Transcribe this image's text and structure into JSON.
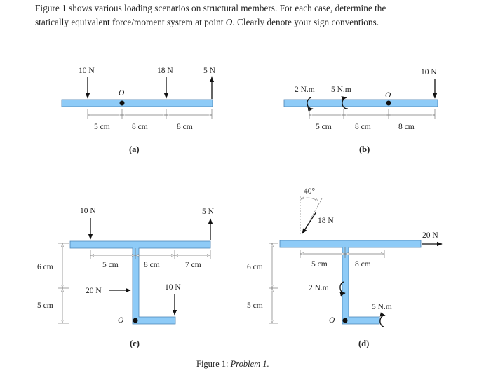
{
  "intro": {
    "line1": "Figure 1 shows various loading scenarios on structural members.  For each case, determine the",
    "line2_a": "statically equivalent force/moment system at point ",
    "line2_point": "O",
    "line2_b": ". Clearly denote your sign conventions."
  },
  "figure": {
    "caption_prefix": "Figure 1:",
    "caption_title": "Problem 1.",
    "colors": {
      "beam": "#8ecbf7",
      "beam_edge": "#4a82b4",
      "arrow": "#111111",
      "dimension": "#777777"
    },
    "point_label": "O",
    "panels": {
      "a": {
        "label": "(a)",
        "forces": [
          {
            "text": "10 N",
            "direction": "down"
          },
          {
            "text": "18 N",
            "direction": "down"
          },
          {
            "text": "5 N",
            "direction": "up"
          }
        ],
        "dims": [
          "5 cm",
          "8 cm",
          "8 cm"
        ]
      },
      "b": {
        "label": "(b)",
        "forces": [
          {
            "text": "10 N",
            "direction": "down"
          }
        ],
        "moments": [
          {
            "text": "2 N.m",
            "sense": "counter-clockwise"
          },
          {
            "text": "5 N.m",
            "sense": "clockwise"
          }
        ],
        "dims": [
          "5 cm",
          "8 cm",
          "8 cm"
        ]
      },
      "c": {
        "label": "(c)",
        "forces": [
          {
            "text": "10 N",
            "direction": "down"
          },
          {
            "text": "5 N",
            "direction": "up"
          },
          {
            "text": "20 N",
            "direction": "right"
          },
          {
            "text": "10 N",
            "direction": "down"
          }
        ],
        "dims_h": [
          "5 cm",
          "8 cm",
          "7 cm"
        ],
        "dims_v": [
          "6 cm",
          "5 cm"
        ]
      },
      "d": {
        "label": "(d)",
        "angle": "40°",
        "forces": [
          {
            "text": "18 N",
            "direction": "inclined"
          },
          {
            "text": "20 N",
            "direction": "right"
          }
        ],
        "moments": [
          {
            "text": "2 N.m",
            "sense": "counter-clockwise"
          },
          {
            "text": "5 N.m",
            "sense": "clockwise"
          }
        ],
        "dims_h": [
          "5 cm",
          "8 cm"
        ],
        "dims_v": [
          "6 cm",
          "5 cm"
        ]
      }
    }
  }
}
